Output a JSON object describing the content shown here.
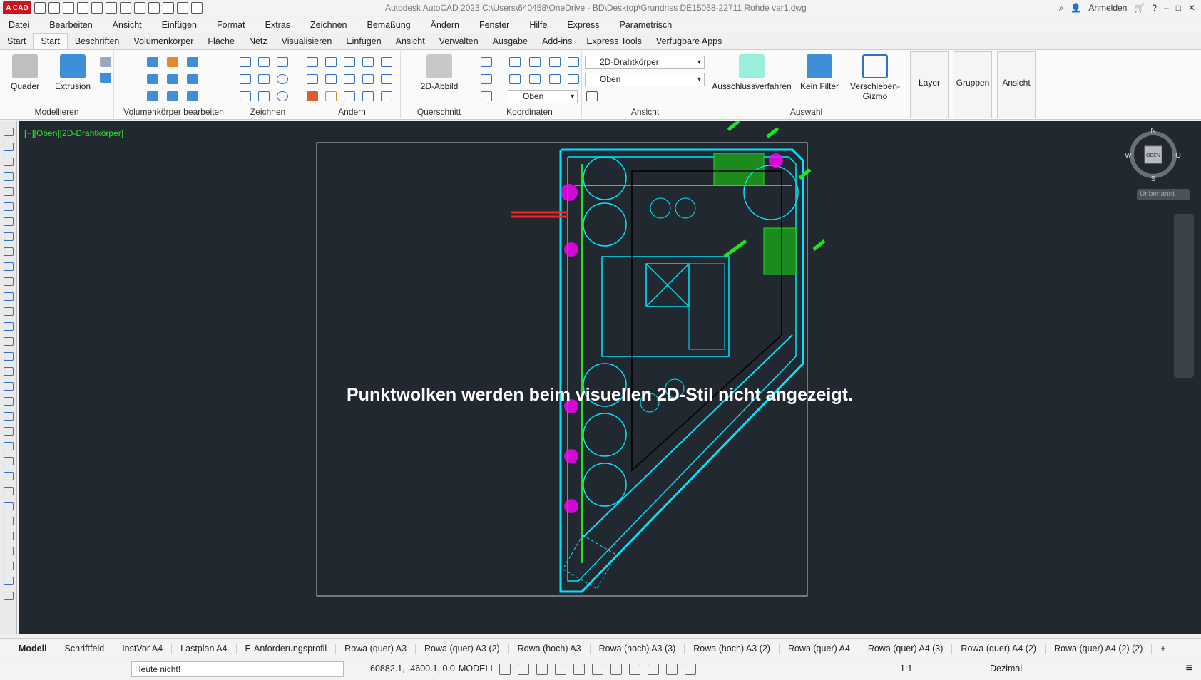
{
  "app": {
    "logo_text": "A CAD",
    "window_title": "Autodesk AutoCAD 2023    C:\\Users\\640458\\OneDrive - BD\\Desktop\\Grundriss DE15058-22711 Rohde var1.dwg",
    "sign_in": "Anmelden"
  },
  "menu": [
    "Datei",
    "Bearbeiten",
    "Ansicht",
    "Einfügen",
    "Format",
    "Extras",
    "Zeichnen",
    "Bemaßung",
    "Ändern",
    "Fenster",
    "Hilfe",
    "Express",
    "Parametrisch"
  ],
  "tabs": [
    "Start",
    "Start",
    "Beschriften",
    "Volumenkörper",
    "Fläche",
    "Netz",
    "Visualisieren",
    "Einfügen",
    "Ansicht",
    "Verwalten",
    "Ausgabe",
    "Add-ins",
    "Express Tools",
    "Verfügbare Apps"
  ],
  "ribbon": {
    "panels": [
      "Modellieren",
      "Volumenkörper bearbeiten",
      "Zeichnen",
      "Ändern",
      "Querschnitt",
      "Koordinaten",
      "Ansicht",
      "Auswahl"
    ],
    "big_buttons": [
      "Quader",
      "Extrusion",
      "2D-Abbild",
      "Ausschlussverfahren",
      "Kein Filter",
      "Verschieben-Gizmo"
    ],
    "combos": {
      "visual_style": "2D-Drahtkörper",
      "view": "Oben",
      "ucs": "Oben"
    },
    "side_buttons": [
      "Layer",
      "Gruppen",
      "Ansicht"
    ]
  },
  "viewport": {
    "label": "[−][Oben][2D-Drahtkörper]",
    "message": "Punktwolken werden beim visuellen 2D-Stil nicht angezeigt.",
    "compass": {
      "n": "N",
      "s": "S",
      "w": "W",
      "o": "O",
      "center": "OBEN"
    },
    "ucs_name": "Unbenannt"
  },
  "layouts": [
    "Modell",
    "Schriftfeld",
    "InstVor A4",
    "Lastplan A4",
    "E-Anforderungsprofil",
    "Rowa (quer) A3",
    "Rowa (quer) A3 (2)",
    "Rowa (hoch) A3",
    "Rowa (hoch) A3 (3)",
    "Rowa (hoch) A3 (2)",
    "Rowa (quer) A4",
    "Rowa (quer) A4 (3)",
    "Rowa (quer) A4 (2)",
    "Rowa (quer) A4 (2) (2)",
    "+"
  ],
  "status": {
    "command": "Heute nicht!",
    "coords": "60882.1, -4600.1, 0.0",
    "space": "MODELL",
    "scale": "1:1",
    "units": "Dezimal"
  },
  "colors": {
    "viewport_bg": "#212830",
    "cyan": "#00e5ff",
    "green": "#22e022",
    "magenta": "#ff00ff",
    "red": "#ff2020"
  }
}
